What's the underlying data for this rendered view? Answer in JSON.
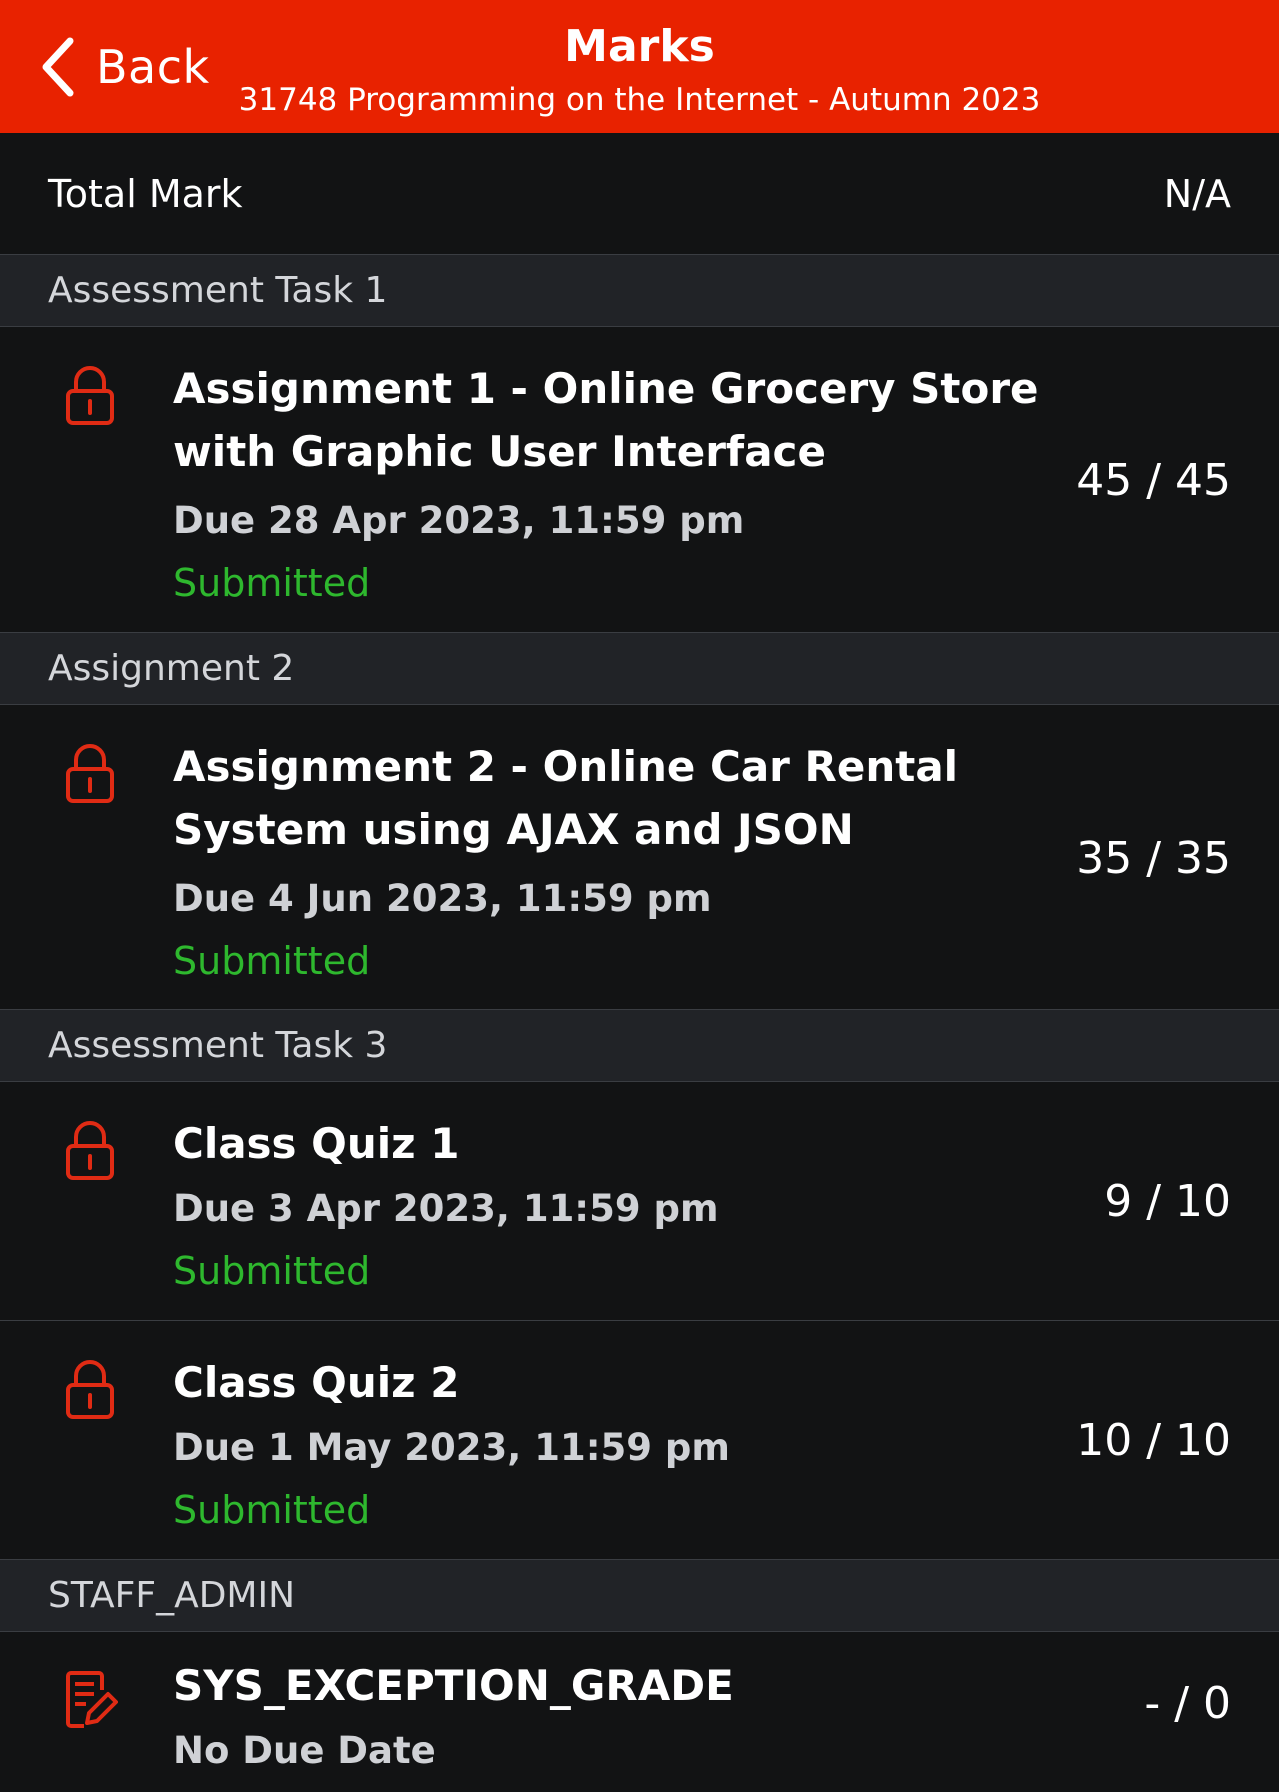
{
  "header": {
    "back_label": "Back",
    "title": "Marks",
    "subtitle": "31748 Programming on the Internet - Autumn 2023",
    "accent_color": "#e82200"
  },
  "total": {
    "label": "Total Mark",
    "value": "N/A"
  },
  "sections": [
    {
      "title": "Assessment Task 1",
      "items": [
        {
          "icon": "lock-icon",
          "name": "Assignment 1 - Online Grocery Store with Graphic User Interface",
          "due": "Due 28 Apr 2023, 11:59 pm",
          "status": "Submitted",
          "mark": "45 / 45"
        }
      ]
    },
    {
      "title": "Assignment 2",
      "items": [
        {
          "icon": "lock-icon",
          "name": "Assignment 2 - Online Car Rental System using AJAX and JSON",
          "due": "Due 4 Jun 2023, 11:59 pm",
          "status": "Submitted",
          "mark": "35 / 35"
        }
      ]
    },
    {
      "title": "Assessment Task 3",
      "items": [
        {
          "icon": "lock-icon",
          "name": "Class Quiz 1",
          "due": "Due 3 Apr 2023, 11:59 pm",
          "status": "Submitted",
          "mark": "9 / 10"
        },
        {
          "icon": "lock-icon",
          "name": "Class Quiz 2",
          "due": "Due 1 May 2023, 11:59 pm",
          "status": "Submitted",
          "mark": "10 / 10"
        }
      ]
    },
    {
      "title": "STAFF_ADMIN",
      "items": [
        {
          "icon": "edit-document-icon",
          "name": "SYS_EXCEPTION_GRADE",
          "due": "No Due Date",
          "mark": "- / 0"
        }
      ]
    }
  ],
  "colors": {
    "status_submitted": "#2eb82e",
    "icon_red": "#e02b14",
    "background": "#121314",
    "section_background": "#212327"
  }
}
